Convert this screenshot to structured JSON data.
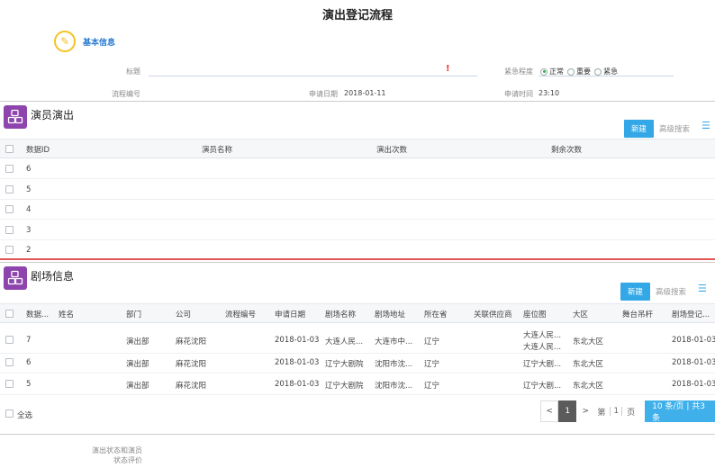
{
  "page_title": "演出登记流程",
  "basic_info": {
    "label": "基本信息",
    "icon": "pencil-icon"
  },
  "form": {
    "title_label": "标题",
    "urgency_label": "紧急程度",
    "urgency_options": [
      "正常",
      "重要",
      "紧急"
    ],
    "urgency_selected": "正常",
    "flow_no_label": "流程编号",
    "apply_date_label": "申请日期",
    "apply_date_value": "2018-01-11",
    "apply_time_label": "申请时间",
    "apply_time_value": "23:10",
    "required_mark": "!"
  },
  "panel1": {
    "title": "演员演出",
    "new_label": "新建",
    "adv_label": "高级搜索",
    "headers": [
      "数据ID",
      "演员名称",
      "演出次数",
      "剩余次数"
    ],
    "rows": [
      {
        "id": "6"
      },
      {
        "id": "5"
      },
      {
        "id": "4"
      },
      {
        "id": "3"
      },
      {
        "id": "2"
      }
    ]
  },
  "panel2": {
    "title": "剧场信息",
    "new_label": "新建",
    "adv_label": "高级搜索",
    "headers": [
      "数据...",
      "姓名",
      "部门",
      "公司",
      "流程编号",
      "申请日期",
      "剧场名称",
      "剧场地址",
      "所在省",
      "关联供应商",
      "座位图",
      "大区",
      "舞台吊杆",
      "剧场登记..."
    ],
    "rows": [
      {
        "id": "7",
        "dept": "演出部",
        "company": "麻花沈阳",
        "date": "2018-01-03",
        "theater": "大连人民...",
        "addr": "大连市中...",
        "prov": "辽宁",
        "seat1": "大连人民...",
        "seat2": "大连人民...",
        "region": "东北大区",
        "reg": "2018-01-03"
      },
      {
        "id": "6",
        "dept": "演出部",
        "company": "麻花沈阳",
        "date": "2018-01-03",
        "theater": "辽宁大剧院",
        "addr": "沈阳市沈...",
        "prov": "辽宁",
        "seat1": "辽宁大剧...",
        "seat2": "",
        "region": "东北大区",
        "reg": "2018-01-03"
      },
      {
        "id": "5",
        "dept": "演出部",
        "company": "麻花沈阳",
        "date": "2018-01-03",
        "theater": "辽宁大剧院",
        "addr": "沈阳市沈...",
        "prov": "辽宁",
        "seat1": "辽宁大剧...",
        "seat2": "",
        "region": "东北大区",
        "reg": "2018-01-03"
      }
    ],
    "select_all": "全选"
  },
  "pager": {
    "prev": "<",
    "current": "1",
    "next": ">",
    "di": "第",
    "page_input": "1",
    "ye": "页",
    "size_info": "10 条/页 | 共3条"
  },
  "footer": {
    "line1": "演出状态和演员",
    "line2": "状态评价"
  }
}
